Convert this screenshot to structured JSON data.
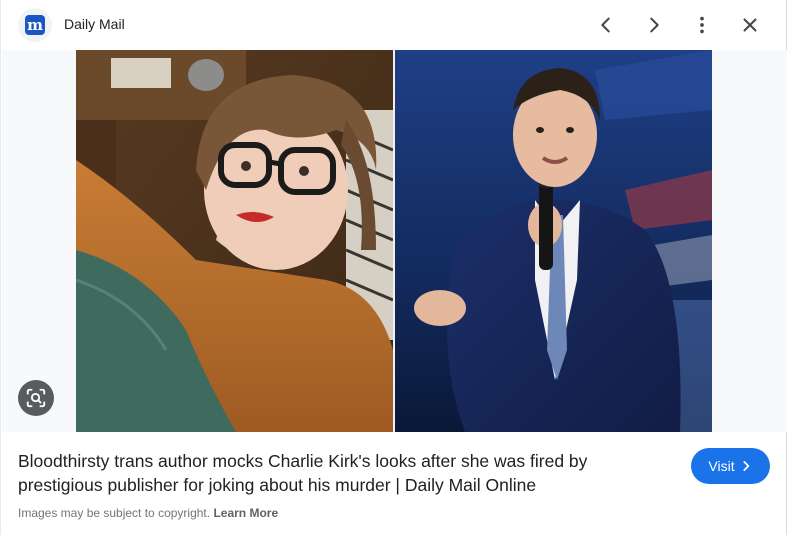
{
  "header": {
    "site_name": "Daily Mail",
    "favicon_letter": "m",
    "buttons": {
      "prev_icon": "chevron-left-icon",
      "next_icon": "chevron-right-icon",
      "more_icon": "more-vert-icon",
      "close_icon": "close-icon"
    }
  },
  "image": {
    "left_photo_desc": "selfie of author",
    "right_photo_desc": "Charlie Kirk speaking on stage"
  },
  "caption": {
    "title": "Bloodthirsty trans author mocks Charlie Kirk's looks after she was fired by prestigious publisher for joking about his murder | Daily Mail Online",
    "copyright_text": "Images may be subject to copyright.",
    "learn_more": "Learn More"
  },
  "visit": {
    "label": "Visit"
  },
  "colors": {
    "accent": "#1a73e8",
    "favicon_bg": "#1a56c4"
  }
}
